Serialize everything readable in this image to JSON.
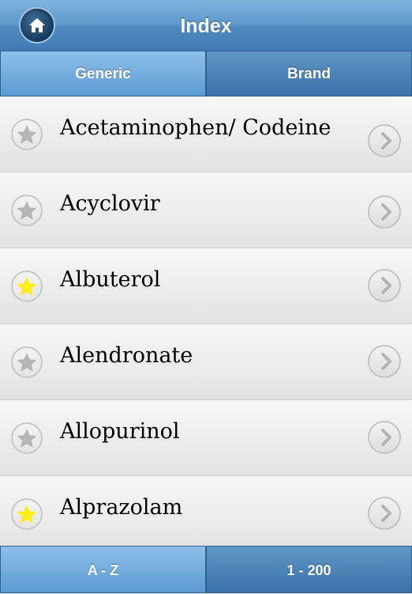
{
  "navbar": {
    "title": "Index",
    "home_icon": "home-icon"
  },
  "tabs": [
    {
      "label": "Generic",
      "active": true
    },
    {
      "label": "Brand",
      "active": false
    }
  ],
  "list": {
    "items": [
      {
        "label": "Acetaminophen/ Codeine",
        "favorite": false
      },
      {
        "label": "Acyclovir",
        "favorite": false
      },
      {
        "label": "Albuterol",
        "favorite": true
      },
      {
        "label": "Alendronate",
        "favorite": false
      },
      {
        "label": "Allopurinol",
        "favorite": false
      },
      {
        "label": "Alprazolam",
        "favorite": true
      }
    ]
  },
  "bottom_tabs": [
    {
      "label": "A - Z",
      "active": true
    },
    {
      "label": "1 - 200",
      "active": false
    }
  ],
  "colors": {
    "accent": "#5f9acd",
    "favorite_star": "#ffee1a",
    "star_off": "#b5b5b5"
  }
}
